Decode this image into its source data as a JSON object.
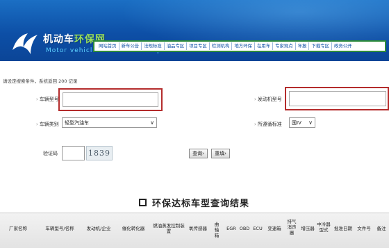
{
  "header": {
    "title_main": "机动车",
    "title_accent": "环保网",
    "subtitle": "Motor vehicle environmental protection"
  },
  "nav": [
    "网站首页",
    "新车公告",
    "法规标准",
    "油品专区",
    "项目专区",
    "检测机构",
    "地方环保",
    "在用车",
    "专家观点",
    "年报",
    "下载专区",
    "政务公开"
  ],
  "status_text": "请设定搜索条件，系统返回 200 记录",
  "form": {
    "vehicle_model_label": "车辆型号",
    "engine_model_label": "发动机型号",
    "vehicle_type_label": "车辆类别",
    "vehicle_type_value": "轻型汽油车",
    "standard_label": "所遵循标准",
    "standard_value": "国IV",
    "captcha_label": "验证码",
    "captcha_text": "1839"
  },
  "buttons": {
    "search": "查询",
    "reset": "重填"
  },
  "results": {
    "title": "环保达标车型查询结果",
    "columns": [
      "厂家名称",
      "车辆型号/名称",
      "发动机/企业",
      "催化转化器",
      "燃油蒸发控制装置",
      "氧传感器",
      "曲轴箱",
      "EGR",
      "OBD",
      "ECU",
      "变速箱",
      "排气消声器",
      "增压器",
      "中冷器型式",
      "批准日期",
      "文件号",
      "备注"
    ]
  },
  "colors": {
    "header_blue": "#0d4fa6",
    "nav_border": "#2d8a3a",
    "highlight_red": "#b42c2c",
    "title_accent": "#9be05a"
  }
}
